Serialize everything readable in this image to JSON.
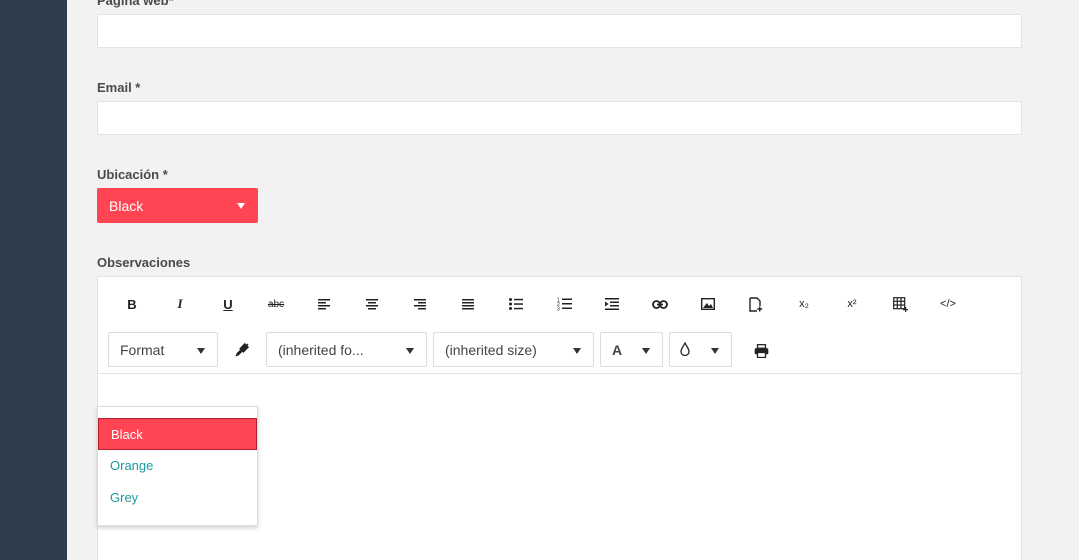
{
  "form": {
    "website_label": "Página web*",
    "email_label": "Email *",
    "location_label": "Ubicación *",
    "location_value": "Black",
    "notes_label": "Observaciones"
  },
  "editor": {
    "toolbar": {
      "row1_icons": [
        "bold-icon",
        "italic-icon",
        "underline-icon",
        "strikethrough-icon",
        "align-left-icon",
        "align-center-icon",
        "align-right-icon",
        "align-justify-icon",
        "unordered-list-icon",
        "ordered-list-icon",
        "indent-icon",
        "link-icon",
        "image-icon",
        "file-add-icon",
        "subscript-icon",
        "superscript-icon",
        "table-icon",
        "code-view-icon"
      ],
      "bold": "B",
      "italic": "I",
      "underline": "U",
      "strike": "abc",
      "subscript": "x₂",
      "superscript": "x²",
      "code": "</>",
      "format_label": "Format",
      "font_family": "(inherited fo...",
      "font_size": "(inherited size)",
      "text_color": "A"
    }
  },
  "dropdown": {
    "options": [
      "Black",
      "Orange",
      "Grey"
    ],
    "selected": "Black"
  },
  "colors": {
    "accent": "#ff4553",
    "sidebar": "#2f3e4e",
    "link": "#1a9aa0"
  }
}
